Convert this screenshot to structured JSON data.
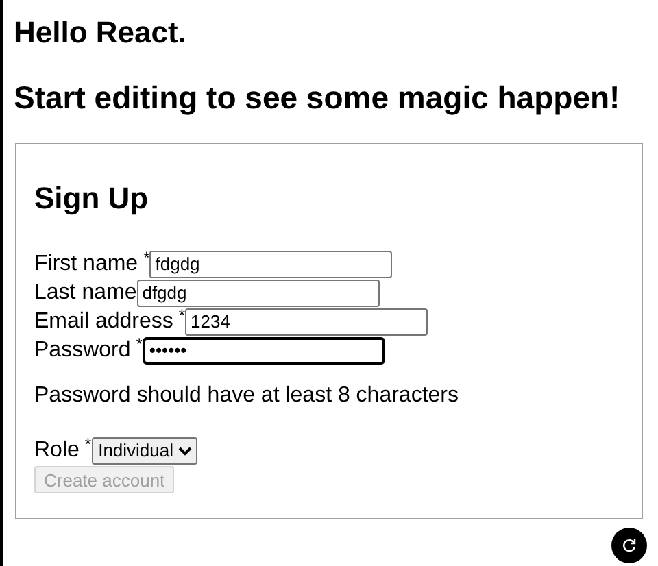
{
  "headings": [
    "Hello React.",
    "Start editing to see some magic happen!"
  ],
  "form": {
    "title": "Sign Up",
    "fields": [
      {
        "label": "First name",
        "required_mark": "*",
        "value": "fdgdg",
        "focused": false
      },
      {
        "label": "Last name",
        "value": "dfgdg",
        "focused": false
      },
      {
        "label": "Email address",
        "required_mark": "*",
        "value": "1234",
        "focused": false
      },
      {
        "label": "Password",
        "required_mark": "*",
        "value": "••••••",
        "focused": true
      }
    ],
    "message": "Password should have at least 8 characters",
    "role": {
      "label": "Role",
      "required_mark": "*",
      "value": "Individual"
    },
    "submit": {
      "label": "Create account",
      "disabled": true
    }
  }
}
